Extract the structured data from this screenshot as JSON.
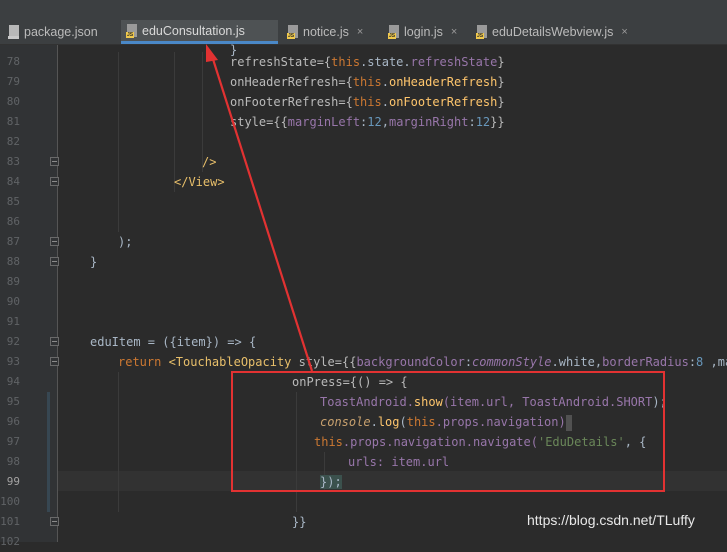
{
  "tabs": [
    {
      "label": "package.json",
      "type": "json",
      "active": false
    },
    {
      "label": "eduConsultation.js",
      "type": "js",
      "active": true
    },
    {
      "label": "notice.js",
      "type": "js",
      "active": false
    },
    {
      "label": "login.js",
      "type": "js",
      "active": false
    },
    {
      "label": "eduDetailsWebview.js",
      "type": "js",
      "active": false
    }
  ],
  "icons": {
    "js_badge": "JS",
    "close": "×"
  },
  "line_numbers": [
    "78",
    "79",
    "80",
    "81",
    "82",
    "83",
    "84",
    "85",
    "86",
    "87",
    "88",
    "89",
    "90",
    "91",
    "92",
    "93",
    "94",
    "95",
    "96",
    "97",
    "98",
    "99",
    "100",
    "101",
    "102"
  ],
  "current_line": "99",
  "code": {
    "l77": "}",
    "l78": {
      "a": "refreshState={",
      "b": "this",
      "c": ".state.",
      "d": "refreshState",
      "e": "}"
    },
    "l79": {
      "a": "onHeaderRefresh={",
      "b": "this",
      "c": ".",
      "d": "onHeaderRefresh",
      "e": "}"
    },
    "l80": {
      "a": "onFooterRefresh={",
      "b": "this",
      "c": ".",
      "d": "onFooterRefresh",
      "e": "}"
    },
    "l81": {
      "a": "style={{",
      "b": "marginLeft",
      "c": ":",
      "d": "12",
      "e": ",",
      "f": "marginRight",
      "g": ":",
      "h": "12",
      "i": "}}"
    },
    "l83": "/>",
    "l84": "</View>",
    "l87": ");",
    "l88": "}",
    "l92": {
      "a": "eduItem = ({item}) => {"
    },
    "l93": {
      "a": "return ",
      "b": "<TouchableOpacity",
      "c": " style={{",
      "d": "backgroundColor",
      "e": ":",
      "f": "commonStyle",
      "g": ".white,",
      "h": "borderRadius",
      "i": ":",
      "j": "8",
      "k": " ,marg"
    },
    "l94": {
      "a": "onPress={() => {"
    },
    "l95": {
      "a": "ToastAndroid.",
      "b": "show",
      "c": "(item.url, ToastAndroid.",
      "d": "SHORT",
      "e": ");"
    },
    "l96": {
      "a": "console",
      "b": ".",
      "c": "log",
      "d": "(",
      "e": "this",
      "f": ".props.navigation)"
    },
    "l97": {
      "a": "this",
      "b": ".props.navigation.navigate(",
      "c": "'EduDetails'",
      "d": ", {"
    },
    "l98": {
      "a": "urls: item.url"
    },
    "l99": {
      "a": "});"
    },
    "l102": "}}"
  },
  "watermark": "https://blog.csdn.net/TLuffy",
  "colors": {
    "annotation": "#e23232",
    "active_tab_underline": "#4a88c7",
    "editor_bg": "#2b2b2b"
  }
}
